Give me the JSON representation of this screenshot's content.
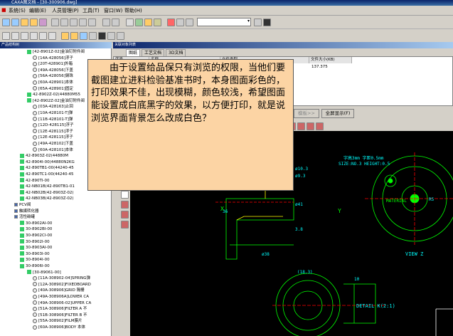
{
  "window": {
    "title": "CAXA图文档 - [30-300906.dwg]"
  },
  "menu": {
    "items": [
      "系统(S)",
      "编辑(E)",
      "人员管理(P)",
      "工具(T)",
      "窗口(W)",
      "帮助(H)"
    ]
  },
  "left_panel": {
    "header": "产品结构树",
    "tree": [
      {
        "text": "[42-8901Z-02]金油钉附件阀",
        "level": 3,
        "type": "asm"
      },
      {
        "text": "[14A-428056]浮子",
        "level": 4,
        "type": "part"
      },
      {
        "text": "[20T-428901]外箱",
        "level": 4,
        "type": "part"
      },
      {
        "text": "[49A-428056]下盖",
        "level": 4,
        "type": "part"
      },
      {
        "text": "[56A-428056]钢珠",
        "level": 4,
        "type": "part"
      },
      {
        "text": "[60A-428901]本体",
        "level": 4,
        "type": "part"
      },
      {
        "text": "[65A-428901]固定",
        "level": 4,
        "type": "part"
      },
      {
        "text": "42-8902Z-02(44880M55",
        "level": 3,
        "type": "asm"
      },
      {
        "text": "[42-8902Z-02]金油钉附件阀",
        "level": 3,
        "type": "asm"
      },
      {
        "text": "[03A-428163]止回",
        "level": 4,
        "type": "part"
      },
      {
        "text": "[10A-428101-T]弹",
        "level": 4,
        "type": "part"
      },
      {
        "text": "[11B-428101-T]弹",
        "level": 4,
        "type": "part"
      },
      {
        "text": "[12D-428115]浮子",
        "level": 4,
        "type": "part"
      },
      {
        "text": "[12E-428115]浮子",
        "level": 4,
        "type": "part"
      },
      {
        "text": "[12E-428115]浮子",
        "level": 4,
        "type": "part"
      },
      {
        "text": "[49A-428102]下盖",
        "level": 4,
        "type": "part"
      },
      {
        "text": "[60A-428101]本体",
        "level": 4,
        "type": "part"
      },
      {
        "text": "42-8903Z-02(44880M",
        "level": 2,
        "type": "asm"
      },
      {
        "text": "42-8904I-00(44880N2KG",
        "level": 2,
        "type": "asm"
      },
      {
        "text": "42-890TB1-00(44240-45",
        "level": 2,
        "type": "asm"
      },
      {
        "text": "42-890TC1-00(44240-45",
        "level": 2,
        "type": "asm"
      },
      {
        "text": "42-890TI-00",
        "level": 2,
        "type": "asm"
      },
      {
        "text": "42-NB01B(42-890TB1-01",
        "level": 2,
        "type": "asm"
      },
      {
        "text": "42-NB02B(42-8903Z-02)",
        "level": 2,
        "type": "asm"
      },
      {
        "text": "42-NB03B(42-8903Z-02)",
        "level": 2,
        "type": "asm"
      },
      {
        "text": "PCV阀",
        "level": 1,
        "type": "folder"
      },
      {
        "text": "触媒转化器",
        "level": 1,
        "type": "folder"
      },
      {
        "text": "活性碳罐",
        "level": 1,
        "type": "folder"
      },
      {
        "text": "30-8902AI-00",
        "level": 2,
        "type": "asm"
      },
      {
        "text": "30-8902BI-00",
        "level": 2,
        "type": "asm"
      },
      {
        "text": "30-8902CI-00",
        "level": 2,
        "type": "asm"
      },
      {
        "text": "30-8902I-00",
        "level": 2,
        "type": "asm"
      },
      {
        "text": "30-8903AI-00",
        "level": 2,
        "type": "asm"
      },
      {
        "text": "30-8903I-00",
        "level": 2,
        "type": "asm"
      },
      {
        "text": "30-8904I-00",
        "level": 2,
        "type": "asm"
      },
      {
        "text": "30-8906I-00",
        "level": 2,
        "type": "asm"
      },
      {
        "text": "[30-89061-00]",
        "level": 3,
        "type": "asm"
      },
      {
        "text": "[11A-308902-04]SPRING弹",
        "level": 4,
        "type": "part"
      },
      {
        "text": "[12A-308902]FIXEDBOARD",
        "level": 4,
        "type": "part"
      },
      {
        "text": "[40A-308906]GRID 隔栅",
        "level": 4,
        "type": "part"
      },
      {
        "text": "[49A-308906A]LOWER CA",
        "level": 4,
        "type": "part"
      },
      {
        "text": "[49A-308906-02]UPPER CA",
        "level": 4,
        "type": "part"
      },
      {
        "text": "[51A-308906]FILTER A 不",
        "level": 4,
        "type": "part"
      },
      {
        "text": "[51B-308906]FILTER B 不",
        "level": 4,
        "type": "part"
      },
      {
        "text": "[55A-308902]FILM膜片",
        "level": 4,
        "type": "part"
      },
      {
        "text": "[60A-308906]BODY 本体",
        "level": 4,
        "type": "part"
      }
    ]
  },
  "right_panel": {
    "header": "关联对象列表",
    "tabs": [
      "图纸",
      "工艺文档",
      "3D文档"
    ],
    "table": {
      "columns": [
        "序号",
        "名称",
        "文件类型",
        "文件大小(KB)"
      ],
      "rows": [
        {
          "size": "137.375"
        }
      ]
    },
    "buttons": {
      "prev": "模板>>",
      "full": "全屏显示(F)"
    }
  },
  "cad": {
    "note_font": "字高3mm  字距0.5mm",
    "note_size": "SIZE:NO.3 HEIGHT:0.5",
    "view_label": "VIEW Z",
    "detail_label": "DETAIL K(2:1)",
    "material": "MATERIAL",
    "dims": [
      "ø10.3",
      "ø9.3",
      "R5",
      "ø38",
      "ø41",
      "3.8",
      "(18.3)",
      "10",
      "36"
    ]
  },
  "note": {
    "text": "由于设置给品保只有浏览的权限，当他们要截图建立进料检验基准书时，本身图面彩色的，打印效果不佳，出现模糊，颜色较浅，希望图面能设置成白底黑字的效果，以方便打印，就是说浏览界面背景怎么改成白色？"
  },
  "colors": {
    "note_bg": "#fcd4a4",
    "cad_bg": "#000000",
    "cad_line": "#00ff00",
    "title_bar": "#0a246a"
  }
}
